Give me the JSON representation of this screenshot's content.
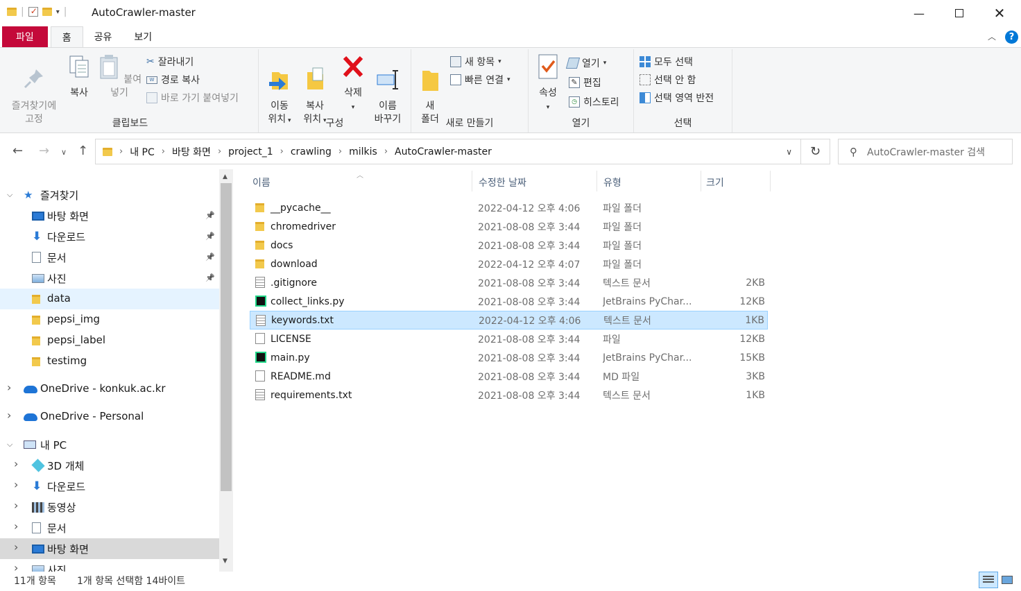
{
  "window": {
    "title": "AutoCrawler-master"
  },
  "tabs": [
    {
      "label": "파일"
    },
    {
      "label": "홈"
    },
    {
      "label": "공유"
    },
    {
      "label": "보기"
    }
  ],
  "ribbon": {
    "clipboard": {
      "group": "클립보드",
      "pin": "즐겨찾기에\n고정",
      "copy": "복사",
      "paste": "붙여넣기",
      "cut": "잘라내기",
      "copy_path": "경로 복사",
      "paste_shortcut": "바로 가기 붙여넣기"
    },
    "organize": {
      "group": "구성",
      "move": "이동\n위치",
      "copy_to": "복사\n위치",
      "delete": "삭제",
      "rename": "이름\n바꾸기"
    },
    "new": {
      "group": "새로 만들기",
      "new_folder": "새\n폴더",
      "new_item": "새 항목",
      "easy_access": "빠른 연결"
    },
    "open": {
      "group": "열기",
      "properties": "속성",
      "open": "열기",
      "edit": "편집",
      "history": "히스토리"
    },
    "select": {
      "group": "선택",
      "select_all": "모두 선택",
      "select_none": "선택 안 함",
      "invert": "선택 영역 반전"
    }
  },
  "address": {
    "crumbs": [
      "내 PC",
      "바탕 화면",
      "project_1",
      "crawling",
      "milkis",
      "AutoCrawler-master"
    ],
    "search_placeholder": "AutoCrawler-master 검색"
  },
  "nav": [
    {
      "label": "즐겨찾기",
      "icon": "star-icon",
      "level": 0,
      "expand": "down"
    },
    {
      "label": "바탕 화면",
      "icon": "desktop-icon",
      "level": 1,
      "pin": true
    },
    {
      "label": "다운로드",
      "icon": "download-icon",
      "level": 1,
      "pin": true
    },
    {
      "label": "문서",
      "icon": "document-icon",
      "level": 1,
      "pin": true
    },
    {
      "label": "사진",
      "icon": "pictures-icon",
      "level": 1,
      "pin": true
    },
    {
      "label": "data",
      "icon": "folder-icon",
      "level": 1,
      "state": "selected"
    },
    {
      "label": "pepsi_img",
      "icon": "folder-icon",
      "level": 1
    },
    {
      "label": "pepsi_label",
      "icon": "folder-icon",
      "level": 1
    },
    {
      "label": "testimg",
      "icon": "folder-icon",
      "level": 1
    },
    {
      "label": "OneDrive - konkuk.ac.kr",
      "icon": "onedrive-icon",
      "level": 0,
      "expand": "right"
    },
    {
      "label": "OneDrive - Personal",
      "icon": "onedrive-icon",
      "level": 0,
      "expand": "right"
    },
    {
      "label": "내 PC",
      "icon": "pc-icon",
      "level": 0,
      "expand": "down"
    },
    {
      "label": "3D 개체",
      "icon": "3d-objects-icon",
      "level": 1,
      "expand": "right"
    },
    {
      "label": "다운로드",
      "icon": "download-icon",
      "level": 1,
      "expand": "right"
    },
    {
      "label": "동영상",
      "icon": "video-icon",
      "level": 1,
      "expand": "right"
    },
    {
      "label": "문서",
      "icon": "document-icon",
      "level": 1,
      "expand": "right"
    },
    {
      "label": "바탕 화면",
      "icon": "desktop-icon",
      "level": 1,
      "expand": "right",
      "state": "hover"
    },
    {
      "label": "사진",
      "icon": "pictures-icon",
      "level": 1,
      "expand": "right"
    }
  ],
  "columns": {
    "name": "이름",
    "date": "수정한 날짜",
    "type": "유형",
    "size": "크기"
  },
  "files": [
    {
      "name": "__pycache__",
      "date": "2022-04-12 오후 4:06",
      "type": "파일 폴더",
      "size": "",
      "icon": "folder-icon"
    },
    {
      "name": "chromedriver",
      "date": "2021-08-08 오후 3:44",
      "type": "파일 폴더",
      "size": "",
      "icon": "folder-icon"
    },
    {
      "name": "docs",
      "date": "2021-08-08 오후 3:44",
      "type": "파일 폴더",
      "size": "",
      "icon": "folder-icon"
    },
    {
      "name": "download",
      "date": "2022-04-12 오후 4:07",
      "type": "파일 폴더",
      "size": "",
      "icon": "folder-icon"
    },
    {
      "name": ".gitignore",
      "date": "2021-08-08 오후 3:44",
      "type": "텍스트 문서",
      "size": "2KB",
      "icon": "text-file-icon"
    },
    {
      "name": "collect_links.py",
      "date": "2021-08-08 오후 3:44",
      "type": "JetBrains PyChar...",
      "size": "12KB",
      "icon": "pycharm-icon"
    },
    {
      "name": "keywords.txt",
      "date": "2022-04-12 오후 4:06",
      "type": "텍스트 문서",
      "size": "1KB",
      "icon": "text-file-icon",
      "selected": true
    },
    {
      "name": "LICENSE",
      "date": "2021-08-08 오후 3:44",
      "type": "파일",
      "size": "12KB",
      "icon": "blank-file-icon"
    },
    {
      "name": "main.py",
      "date": "2021-08-08 오후 3:44",
      "type": "JetBrains PyChar...",
      "size": "15KB",
      "icon": "pycharm-icon"
    },
    {
      "name": "README.md",
      "date": "2021-08-08 오후 3:44",
      "type": "MD 파일",
      "size": "3KB",
      "icon": "blank-file-icon"
    },
    {
      "name": "requirements.txt",
      "date": "2021-08-08 오후 3:44",
      "type": "텍스트 문서",
      "size": "1KB",
      "icon": "text-file-icon"
    }
  ],
  "status": {
    "count": "11개 항목",
    "selection": "1개 항목 선택함 14바이트"
  },
  "colors": {
    "file_tab": "#c4093a",
    "selection": "#cce8ff",
    "folder": "#f2c94c",
    "accent": "#0078d7"
  }
}
